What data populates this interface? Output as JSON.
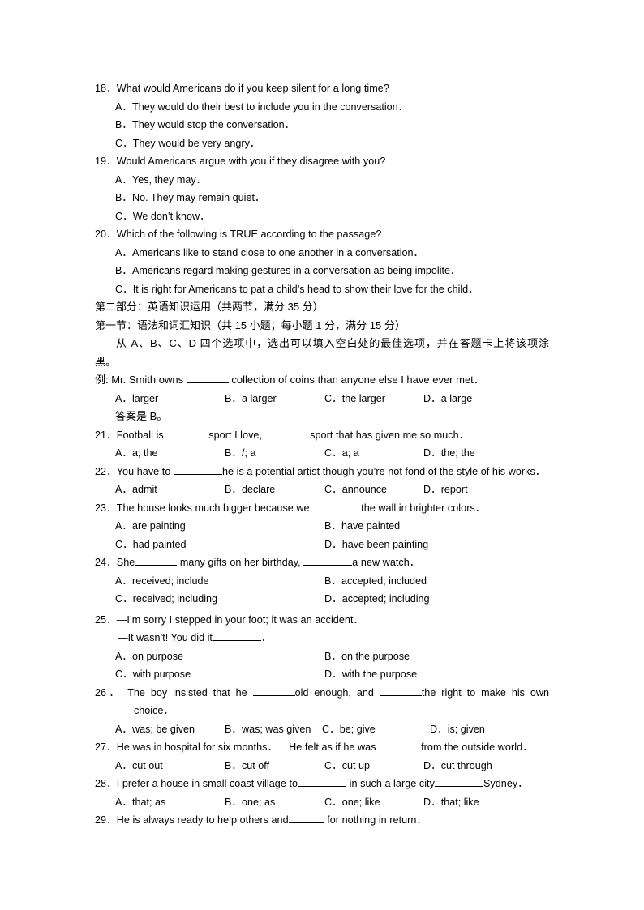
{
  "document": {
    "type": "exam-paper-page",
    "language_mix": "english-chinese"
  },
  "reading_questions": [
    {
      "number": "18．",
      "stem": "What would Americans do if you keep silent for a long time?",
      "options": [
        {
          "label": "A．",
          "text": "They would do their best to include you in the conversation．"
        },
        {
          "label": "B．",
          "text": "They would stop the conversation．"
        },
        {
          "label": "C．",
          "text": "They would be very angry．"
        }
      ]
    },
    {
      "number": "19．",
      "stem": "Would Americans argue with you if they disagree with you?",
      "options": [
        {
          "label": "A．",
          "text": "Yes, they may．"
        },
        {
          "label": "B．",
          "text": "No. They may remain quiet．"
        },
        {
          "label": "C．",
          "text": "We don’t know．"
        }
      ]
    },
    {
      "number": "20．",
      "stem": "Which of the following is TRUE according to the passage?",
      "options": [
        {
          "label": "A．",
          "text": "Americans like to stand close to one another in a conversation．"
        },
        {
          "label": "B．",
          "text": "Americans regard making gestures in a conversation as being impolite．"
        },
        {
          "label": "C．",
          "text": "It is right for Americans to pat a child’s head to show their love for the child．"
        }
      ]
    }
  ],
  "section_headings": {
    "part_two": "第二部分：英语知识运用（共两节，满分 35 分）",
    "section_one": "第一节：语法和词汇知识（共 15 小题；每小题 1 分，满分 15 分）",
    "instruction_line1": "从 A、B、C、D 四个选项中，选出可以填入空白处的最佳选项，并在答题卡上将该项涂",
    "instruction_line2": "黑。"
  },
  "example": {
    "prefix": "例: Mr. Smith owns",
    "suffix": "collection of coins than anyone else I have ever met．",
    "options": [
      {
        "label": "A．",
        "text": "larger"
      },
      {
        "label": "B．",
        "text": "a larger"
      },
      {
        "label": "C．",
        "text": "the larger"
      },
      {
        "label": "D．",
        "text": "a large"
      }
    ],
    "answer_text": "答案是 B。"
  },
  "grammar_questions": [
    {
      "number": "21．",
      "stem_part1": "Football is",
      "stem_part2": "sport I love,",
      "stem_part3": "sport that has given me so much．",
      "layout": "four-column",
      "options": [
        {
          "label": "A．",
          "text": "a; the"
        },
        {
          "label": "B．",
          "text": "/; a"
        },
        {
          "label": "C．",
          "text": "a; a"
        },
        {
          "label": "D．",
          "text": "the; the"
        }
      ]
    },
    {
      "number": "22．",
      "stem_part1": "You have to",
      "stem_part2": "he is a potential artist though you’re not fond of the style of his works．",
      "layout": "four-column",
      "options": [
        {
          "label": "A．",
          "text": "admit"
        },
        {
          "label": "B．",
          "text": "declare"
        },
        {
          "label": "C．",
          "text": "announce"
        },
        {
          "label": "D．",
          "text": "report"
        }
      ]
    },
    {
      "number": "23．",
      "stem_part1": "The house looks much bigger because we",
      "stem_part2": "the wall in brighter colors．",
      "layout": "two-column",
      "options": [
        {
          "label": "A．",
          "text": "are painting"
        },
        {
          "label": "B．",
          "text": "have painted"
        },
        {
          "label": "C．",
          "text": "had painted"
        },
        {
          "label": "D．",
          "text": "have been painting"
        }
      ]
    },
    {
      "number": "24．",
      "stem_part1": "She",
      "stem_part2": "many gifts on her birthday,",
      "stem_part3": "a new watch．",
      "layout": "two-column",
      "options": [
        {
          "label": "A．",
          "text": "received; include"
        },
        {
          "label": "B．",
          "text": "accepted; included"
        },
        {
          "label": "C．",
          "text": "received; including"
        },
        {
          "label": "D．",
          "text": "accepted; including"
        }
      ]
    },
    {
      "number": "25．",
      "dialogue_line1": "—I’m sorry I stepped in your foot; it was an accident．",
      "dialogue_line2_prefix": "—It wasn’t! You did it",
      "dialogue_line2_suffix": "．",
      "layout": "two-column",
      "options": [
        {
          "label": "A．",
          "text": "on purpose"
        },
        {
          "label": "B．",
          "text": "on the purpose"
        },
        {
          "label": "C．",
          "text": "with purpose"
        },
        {
          "label": "D．",
          "text": "with the purpose"
        }
      ]
    },
    {
      "number": "26．",
      "stem_part1": "The boy insisted that he",
      "stem_part2": "old enough, and",
      "stem_part3": "the right to make his own",
      "stem_wrapped": "choice．",
      "layout": "four-column-q26",
      "options": [
        {
          "label": "A．",
          "text": "was; be given"
        },
        {
          "label": "B．",
          "text": "was; was given"
        },
        {
          "label": "C．",
          "text": "be; give"
        },
        {
          "label": "D．",
          "text": "is; given"
        }
      ]
    },
    {
      "number": "27．",
      "stem_part1": "He was in hospital for six months．",
      "stem_part2": "He felt as if he was",
      "stem_part3": "from the outside world．",
      "layout": "four-column",
      "options": [
        {
          "label": "A．",
          "text": "cut out"
        },
        {
          "label": "B．",
          "text": "cut off"
        },
        {
          "label": "C．",
          "text": "cut up"
        },
        {
          "label": "D．",
          "text": "cut through"
        }
      ]
    },
    {
      "number": "28．",
      "stem_part1": "I prefer a house in small coast village to",
      "stem_part2": "in such a large city",
      "stem_part3": "Sydney．",
      "layout": "four-column",
      "options": [
        {
          "label": "A．",
          "text": "that; as"
        },
        {
          "label": "B．",
          "text": "one; as"
        },
        {
          "label": "C．",
          "text": "one; like"
        },
        {
          "label": "D．",
          "text": "that; like"
        }
      ]
    },
    {
      "number": "29．",
      "stem_part1": "He is always ready to help others and",
      "stem_part2": "for nothing in return．",
      "layout": "none",
      "options": []
    }
  ]
}
